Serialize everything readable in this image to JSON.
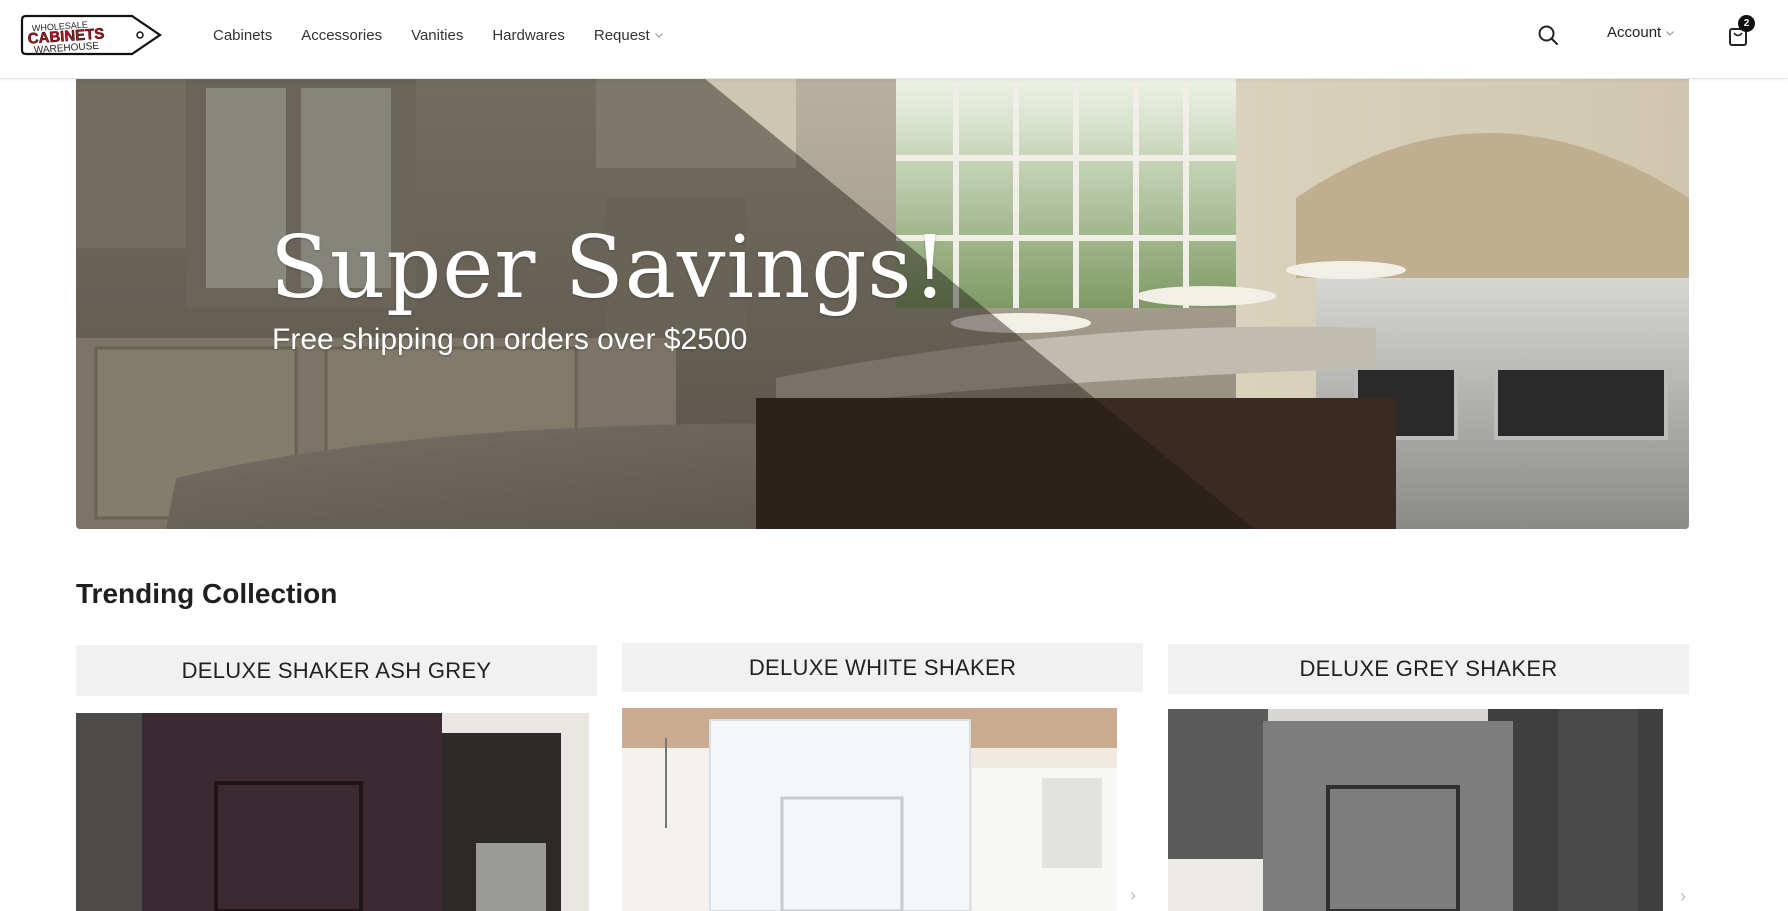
{
  "header": {
    "logo_text": "WHOLESALE CABINETS WAREHOUSE",
    "nav": [
      {
        "label": "Cabinets"
      },
      {
        "label": "Accessories"
      },
      {
        "label": "Vanities"
      },
      {
        "label": "Hardwares"
      },
      {
        "label": "Request"
      }
    ],
    "account_label": "Account",
    "cart_count": "2",
    "icons": {
      "search": "search-icon",
      "cart": "shopping-bag-icon",
      "dropdown": "chevron-down-icon"
    }
  },
  "hero": {
    "title": "Super Savings!",
    "subtitle": "Free shipping on orders over $2500"
  },
  "trending": {
    "title": "Trending Collection",
    "cards": [
      {
        "title": "DELUXE SHAKER ASH GREY",
        "cabinet_color": "#3b2a32"
      },
      {
        "title": "DELUXE WHITE SHAKER",
        "cabinet_color": "#f4f6f8"
      },
      {
        "title": "DELUXE GREY SHAKER",
        "cabinet_color": "#7d7d7d"
      }
    ]
  },
  "colors": {
    "text_dark": "#1f1f1f",
    "card_header_bg": "#f1f1f1",
    "badge_bg": "#111111"
  }
}
